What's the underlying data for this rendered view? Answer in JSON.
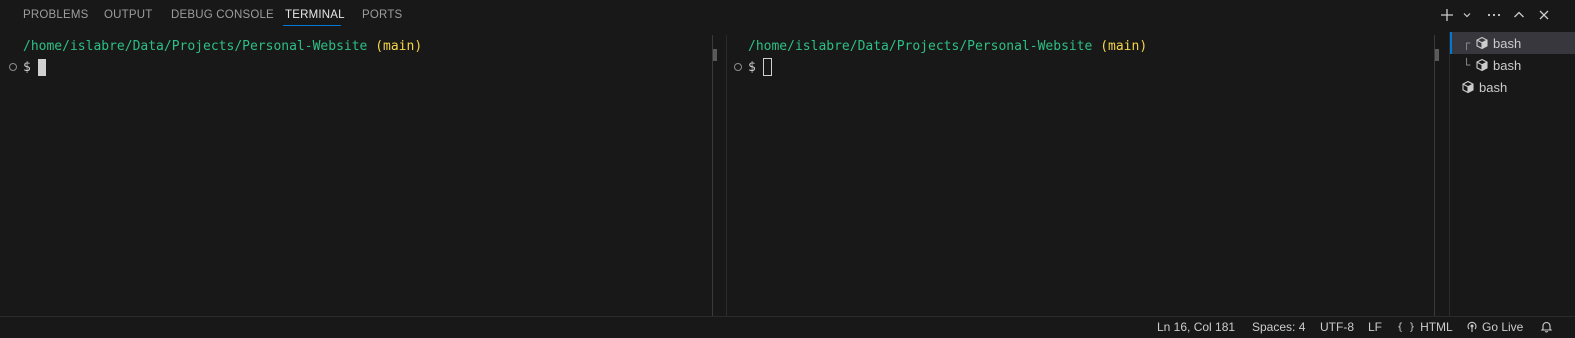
{
  "tabs": [
    "PROBLEMS",
    "OUTPUT",
    "DEBUG CONSOLE",
    "TERMINAL",
    "PORTS"
  ],
  "active_tab": "TERMINAL",
  "accent_color": "#0078d4",
  "terminal_left": {
    "path": "/home/islabre/Data/Projects/Personal-Website",
    "branch": "(main)",
    "prompt": "$"
  },
  "terminal_right": {
    "path": "/home/islabre/Data/Projects/Personal-Website",
    "branch": "(main)",
    "prompt": "$"
  },
  "terminal_list": [
    {
      "label": "bash",
      "tree": "┌",
      "selected": true
    },
    {
      "label": "bash",
      "tree": "└",
      "selected": false
    },
    {
      "label": "bash",
      "tree": "",
      "selected": false
    }
  ],
  "actions": [
    "plus-icon",
    "chevron-down-icon",
    "ellipsis-icon",
    "chevron-up-icon",
    "close-icon"
  ],
  "statusbar": {
    "position": "Ln 16, Col 181",
    "spaces": "Spaces: 4",
    "encoding": "UTF-8",
    "eol": "LF",
    "language": "HTML",
    "language_glyph": "{ }",
    "go_live": "Go Live"
  }
}
